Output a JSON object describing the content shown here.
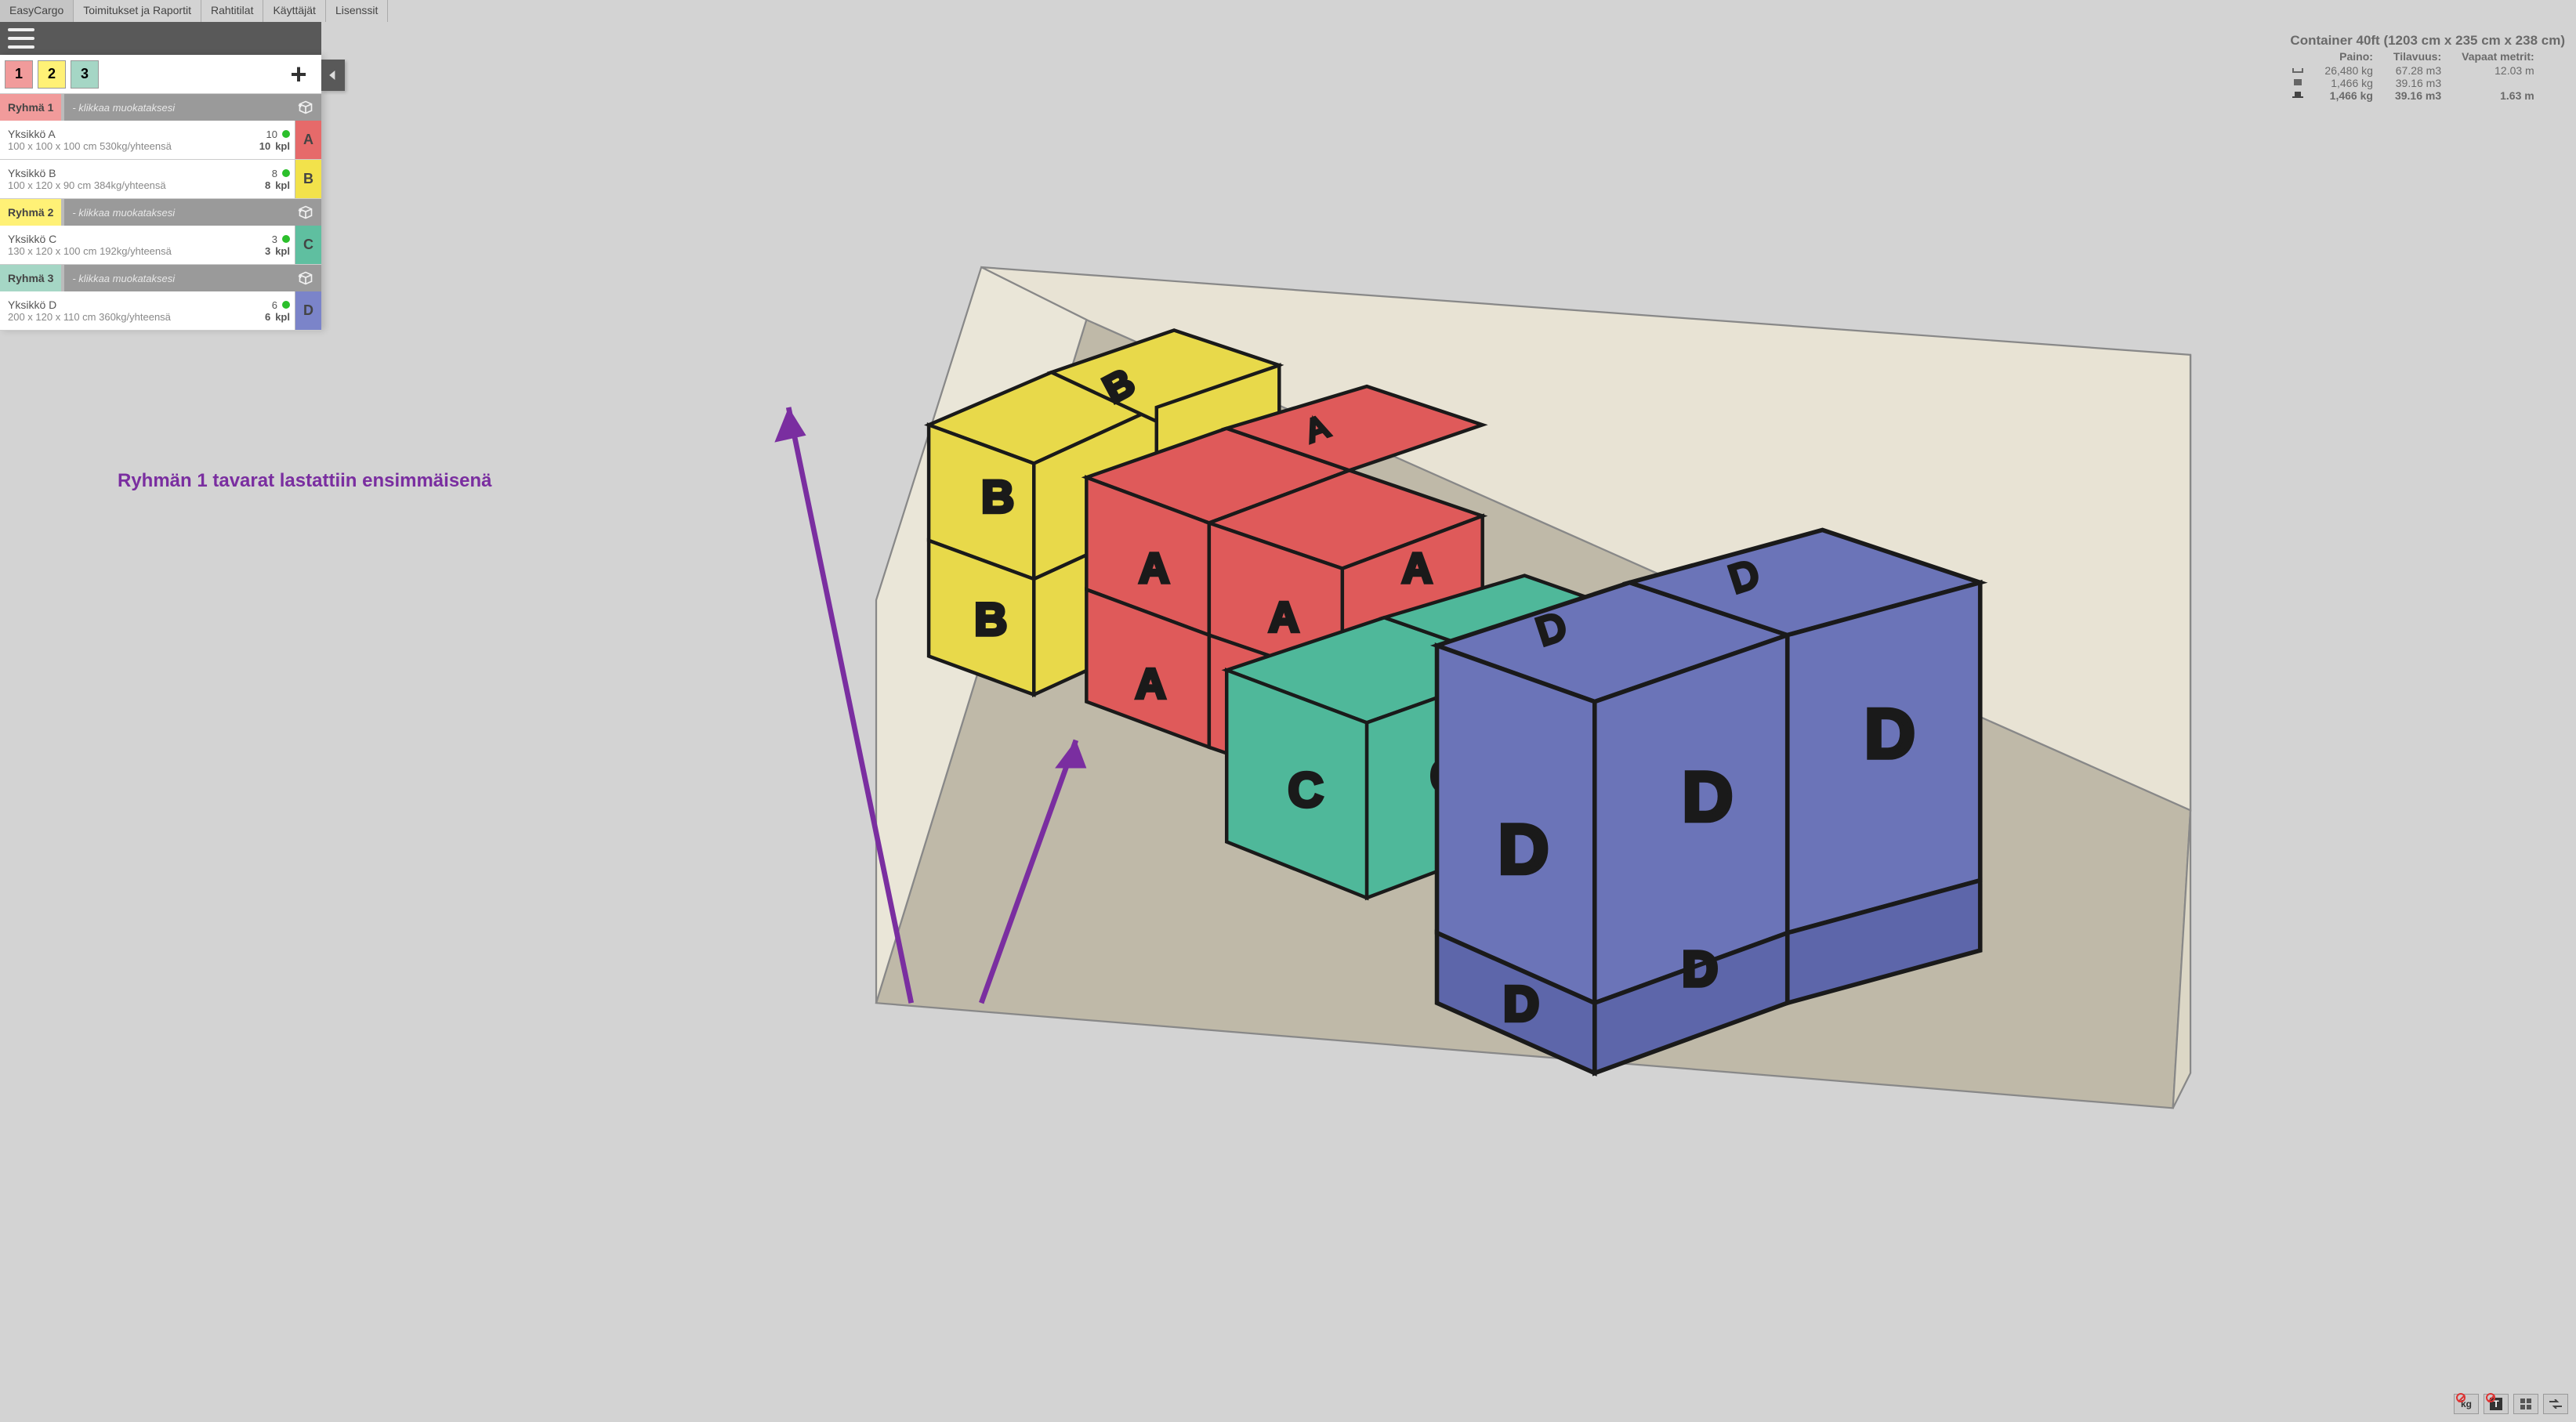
{
  "menu": [
    "EasyCargo",
    "Toimitukset ja Raportit",
    "Rahtitilat",
    "Käyttäjät",
    "Lisenssit"
  ],
  "tabs": [
    {
      "num": "1",
      "bg": "#f19b9b"
    },
    {
      "num": "2",
      "bg": "#fff176"
    },
    {
      "num": "3",
      "bg": "#a5d6c5"
    }
  ],
  "groups": [
    {
      "name": "Ryhmä 1",
      "bg": "#f19b9b",
      "hint": "- klikkaa muokataksesi",
      "items": [
        {
          "name": "Yksikkö A",
          "dims": "100 x 100 x 100 cm 530kg/yhteensä",
          "c1": "10",
          "c2": "10",
          "unit": "kpl",
          "letter": "A",
          "lbg": "#e66a6a"
        },
        {
          "name": "Yksikkö B",
          "dims": "100 x 120 x 90 cm 384kg/yhteensä",
          "c1": "8",
          "c2": "8",
          "unit": "kpl",
          "letter": "B",
          "lbg": "#f2e24b"
        }
      ]
    },
    {
      "name": "Ryhmä 2",
      "bg": "#fff176",
      "hint": "- klikkaa muokataksesi",
      "items": [
        {
          "name": "Yksikkö C",
          "dims": "130 x 120 x 100 cm 192kg/yhteensä",
          "c1": "3",
          "c2": "3",
          "unit": "kpl",
          "letter": "C",
          "lbg": "#5fbfa0"
        }
      ]
    },
    {
      "name": "Ryhmä 3",
      "bg": "#a5d6c5",
      "hint": "- klikkaa muokataksesi",
      "items": [
        {
          "name": "Yksikkö D",
          "dims": "200 x 120 x 110 cm 360kg/yhteensä",
          "c1": "6",
          "c2": "6",
          "unit": "kpl",
          "letter": "D",
          "lbg": "#7b84c9"
        }
      ]
    }
  ],
  "info": {
    "title": "Container 40ft (1203 cm x 235 cm x 238 cm)",
    "headers": {
      "weight": "Paino:",
      "volume": "Tilavuus:",
      "free": "Vapaat metrit:"
    },
    "rows": [
      {
        "icon": "cargo",
        "w": "26,480 kg",
        "v": "67.28 m3",
        "f": "12.03 m"
      },
      {
        "icon": "solid",
        "w": "1,466 kg",
        "v": "39.16 m3",
        "f": ""
      },
      {
        "icon": "loaded",
        "w": "1,466 kg",
        "v": "39.16 m3",
        "f": "1.63 m",
        "bold": true
      }
    ]
  },
  "annotation": "Ryhmän 1 tavarat lastattiin ensimmäisenä",
  "br_buttons": [
    "kg",
    "T",
    "grid",
    "swap"
  ]
}
